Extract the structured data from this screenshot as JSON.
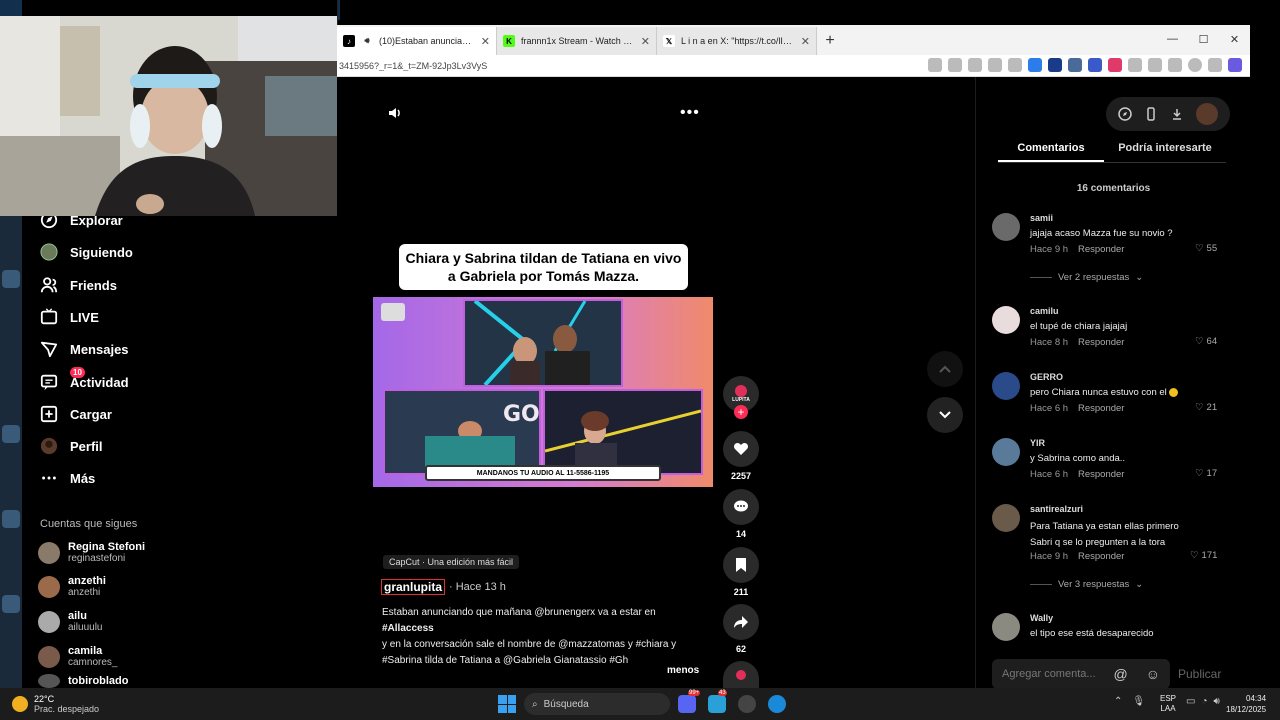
{
  "browser": {
    "tabs": [
      {
        "title": "(10)Estaban anunciando que",
        "icon": "tiktok-icon"
      },
      {
        "title": "frannn1x Stream - Watch Live on",
        "icon": "kick-icon"
      },
      {
        "title": "L i n a en X: \"https://t.co/lIVzmtTi",
        "icon": "x-icon"
      }
    ],
    "url": "3415956?_r=1&_t=ZM-92Jp3Lv3VyS"
  },
  "sidebar": {
    "items": [
      {
        "label": "Explorar",
        "icon": "compass-icon"
      },
      {
        "label": "Siguiendo",
        "icon": "following-avatar-icon"
      },
      {
        "label": "Friends",
        "icon": "friends-icon"
      },
      {
        "label": "LIVE",
        "icon": "live-icon"
      },
      {
        "label": "Mensajes",
        "icon": "messages-icon"
      },
      {
        "label": "Actividad",
        "icon": "activity-icon",
        "badge": "10"
      },
      {
        "label": "Cargar",
        "icon": "upload-icon"
      },
      {
        "label": "Perfil",
        "icon": "profile-icon"
      },
      {
        "label": "Más",
        "icon": "more-icon"
      }
    ],
    "following_heading": "Cuentas que sigues",
    "following": [
      {
        "name": "Regina Stefoni",
        "user": "reginastefoni"
      },
      {
        "name": "anzethi",
        "user": "anzethi"
      },
      {
        "name": "ailu",
        "user": "ailuuulu"
      },
      {
        "name": "camila",
        "user": "camnores_"
      },
      {
        "name": "tobiroblado",
        "user": ""
      }
    ]
  },
  "video": {
    "headline": "Chiara y Sabrina tildan de Tatiana en vivo a Gabriela por Tomás Mazza.",
    "banner": "MANDANOS TU AUDIO AL 11-5586-1195",
    "capcut": "CapCut · Una edición más fácil",
    "author": "granlupita",
    "time": "· Hace 13 h",
    "desc1": "Estaban anunciando que mañana @brunengerx va a estar en",
    "desc2": "#Allaccess",
    "desc3": " y en la conversación sale el nombre de @mazzatomas y #chiara y",
    "desc4": "#Sabrina tilda de Tatiana a @Gabriela Gianatassio #Gh",
    "less": "menos",
    "likes": "2257",
    "comments": "14",
    "saves": "211",
    "shares": "62",
    "avatar_label": "LUPITA"
  },
  "panel": {
    "tabs": [
      "Comentarios",
      "Podría interesarte"
    ],
    "count": "16 comentarios",
    "reply_label": "Responder",
    "comments": [
      {
        "user": "samii",
        "text": "jajaja acaso Mazza fue su novio ?",
        "time": "Hace 9 h",
        "likes": "55",
        "replies": "Ver 2 respuestas"
      },
      {
        "user": "camilu",
        "text": "el tupé de chiara jajajaj",
        "time": "Hace 8 h",
        "likes": "64",
        "replies": ""
      },
      {
        "user": "GERRO",
        "text": "pero Chiara nunca estuvo con el",
        "time": "Hace 6 h",
        "likes": "21",
        "replies": ""
      },
      {
        "user": "YIR",
        "text": "y Sabrina como anda..",
        "time": "Hace 6 h",
        "likes": "17",
        "replies": ""
      },
      {
        "user": "santirealzuri",
        "text": "Para Tatiana ya estan ellas primero\nSabri q se lo pregunten a la tora",
        "time": "Hace 9 h",
        "likes": "171",
        "replies": "Ver 3 respuestas"
      },
      {
        "user": "Wally",
        "text": "el tipo ese está desaparecido",
        "time": "",
        "likes": "",
        "replies": ""
      }
    ],
    "input_placeholder": "Agregar comenta...",
    "publish": "Publicar"
  },
  "taskbar": {
    "weather_temp": "22°C",
    "weather_text": "Prac. despejado",
    "search": "Búsqueda",
    "lang1": "ESP",
    "lang2": "LAA",
    "time": "04:34",
    "date": "18/12/2025",
    "badge1": "99+",
    "badge2": "43"
  }
}
